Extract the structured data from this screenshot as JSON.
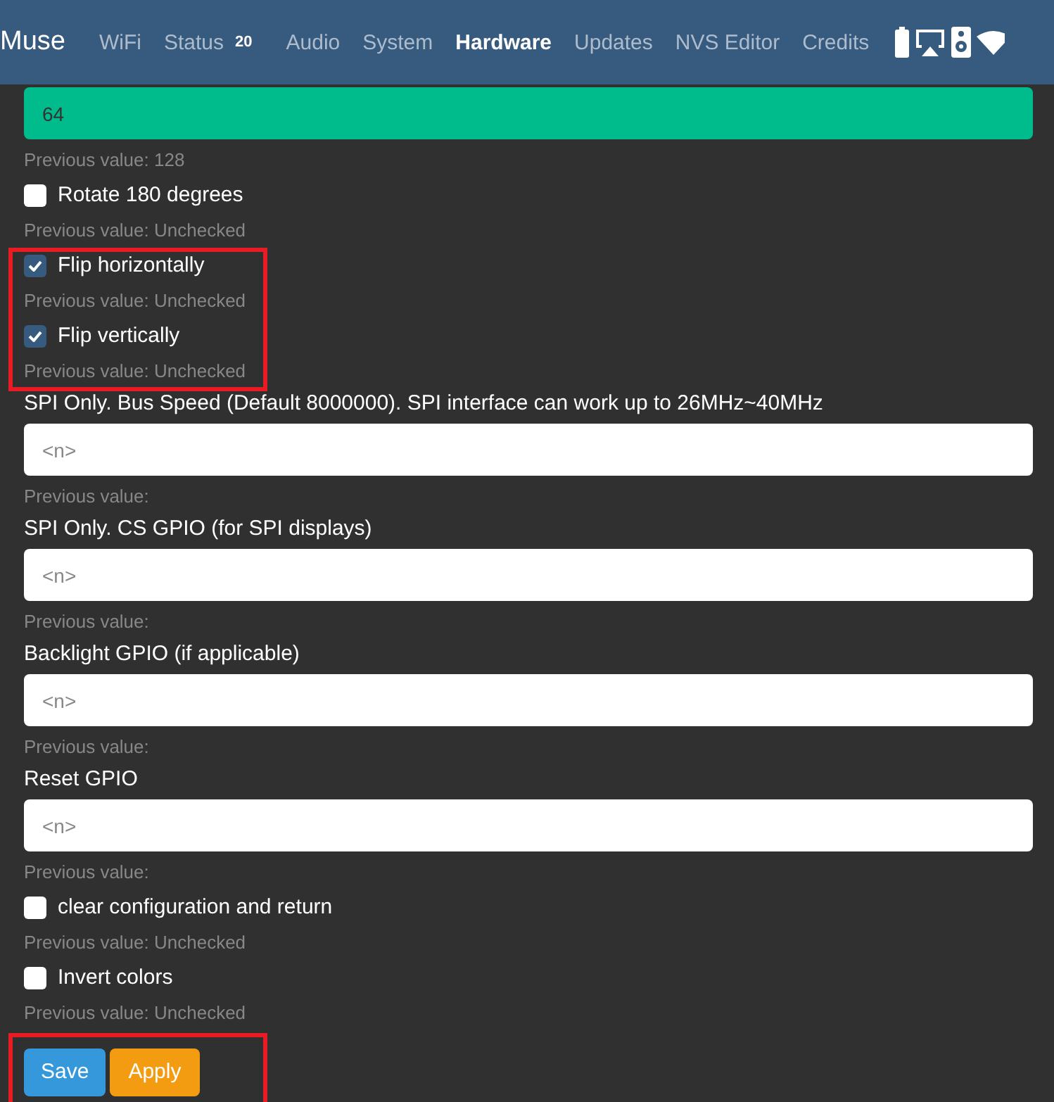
{
  "navbar": {
    "brand": "Muse",
    "tabs": [
      {
        "label": "WiFi",
        "selected": false
      },
      {
        "label": "Status",
        "badge": "20",
        "selected": false
      },
      {
        "label": "Audio",
        "selected": false
      },
      {
        "label": "System",
        "selected": false
      },
      {
        "label": "Hardware",
        "selected": true
      },
      {
        "label": "Updates",
        "selected": false
      },
      {
        "label": "NVS Editor",
        "selected": false
      },
      {
        "label": "Credits",
        "selected": false
      }
    ]
  },
  "groups": [
    {
      "highlighted": false,
      "fields": [
        {
          "kind": "text",
          "value": "64",
          "changed": true,
          "previous": "Previous value: 128"
        },
        {
          "kind": "checkbox",
          "label": "Rotate 180 degrees",
          "checked": false,
          "previous": "Previous value: Unchecked"
        }
      ]
    },
    {
      "highlighted": true,
      "fields": [
        {
          "kind": "checkbox",
          "label": "Flip horizontally",
          "checked": true,
          "previous": "Previous value: Unchecked"
        },
        {
          "kind": "checkbox",
          "label": "Flip vertically",
          "checked": true,
          "previous": "Previous value: Unchecked"
        }
      ]
    },
    {
      "highlighted": false,
      "fields": [
        {
          "kind": "text",
          "label": "SPI Only. Bus Speed (Default 8000000). SPI interface can work up to 26MHz~40MHz",
          "placeholder": "<n>",
          "changed": false,
          "previous": "Previous value:"
        },
        {
          "kind": "text",
          "label": "SPI Only. CS GPIO (for SPI displays)",
          "placeholder": "<n>",
          "changed": false,
          "previous": "Previous value:"
        },
        {
          "kind": "text",
          "label": "Backlight GPIO (if applicable)",
          "placeholder": "<n>",
          "changed": false,
          "previous": "Previous value:"
        },
        {
          "kind": "text",
          "label": "Reset GPIO",
          "placeholder": "<n>",
          "changed": false,
          "previous": "Previous value:"
        },
        {
          "kind": "checkbox",
          "label": "clear configuration and return",
          "checked": false,
          "previous": "Previous value: Unchecked"
        },
        {
          "kind": "checkbox",
          "label": "Invert colors",
          "checked": false,
          "previous": "Previous value: Unchecked"
        }
      ]
    }
  ],
  "actions": {
    "highlighted": true,
    "buttons": [
      {
        "label": "Save",
        "kind": "primary"
      },
      {
        "label": "Apply",
        "kind": "warning"
      }
    ]
  }
}
